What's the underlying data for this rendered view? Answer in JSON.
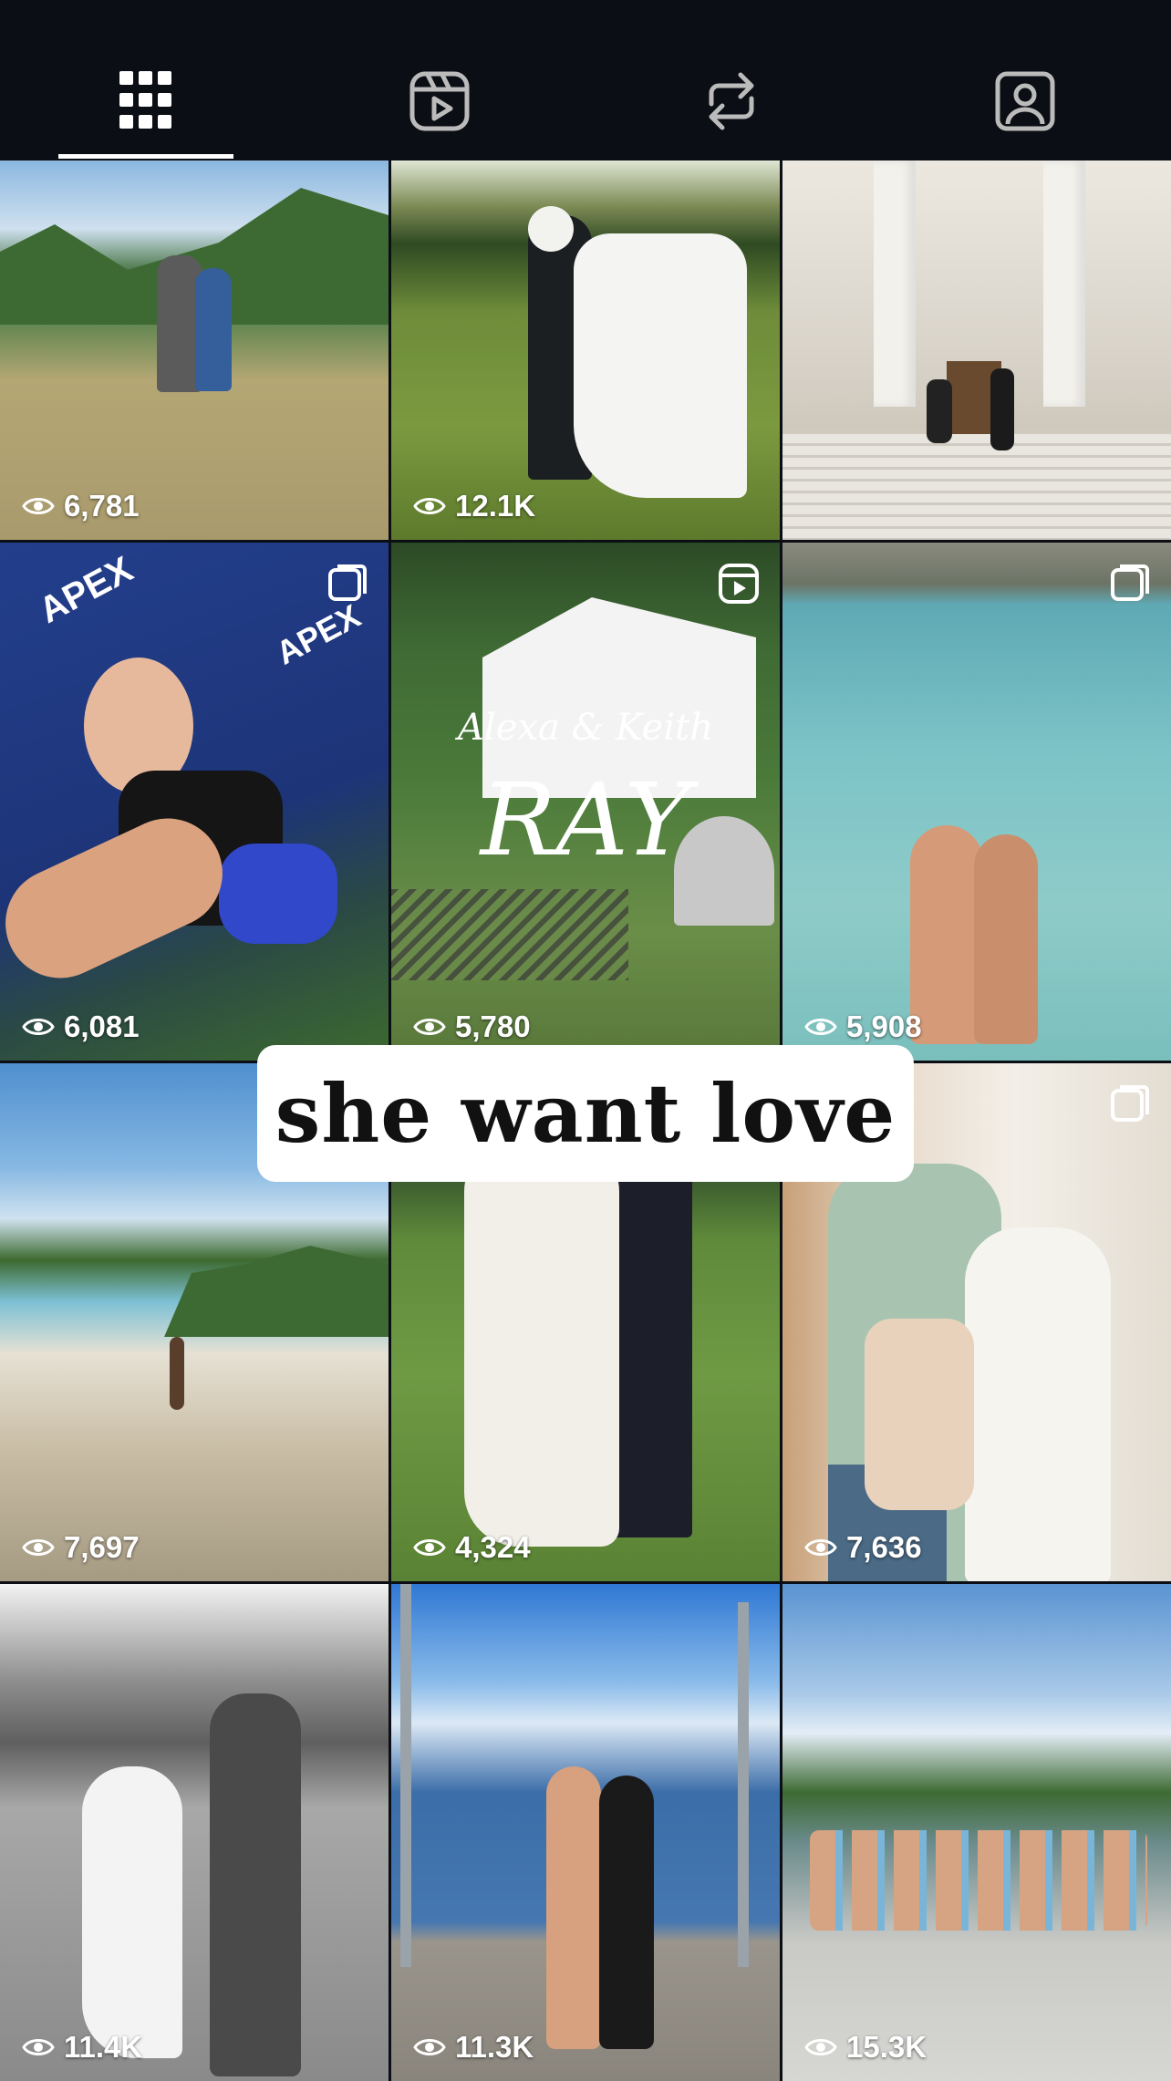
{
  "tabs": [
    {
      "name": "posts",
      "icon": "grid-icon",
      "selected": true
    },
    {
      "name": "reels",
      "icon": "reels-icon",
      "selected": false
    },
    {
      "name": "reposts",
      "icon": "repost-icon",
      "selected": false
    },
    {
      "name": "tagged",
      "icon": "tagged-person-icon",
      "selected": false
    }
  ],
  "posts": [
    {
      "views": "6,781",
      "badge": null
    },
    {
      "views": "12.1K",
      "badge": null
    },
    {
      "views": "",
      "badge": null
    },
    {
      "views": "6,081",
      "badge": "multi-photo-icon"
    },
    {
      "views": "5,780",
      "badge": "reel-icon"
    },
    {
      "views": "5,908",
      "badge": "multi-photo-icon"
    },
    {
      "views": "7,697",
      "badge": null
    },
    {
      "views": "4,324",
      "badge": null
    },
    {
      "views": "7,636",
      "badge": "multi-photo-icon"
    },
    {
      "views": "11.4K",
      "badge": null
    },
    {
      "views": "11.3K",
      "badge": null
    },
    {
      "views": "15.3K",
      "badge": null
    }
  ],
  "post_texts": {
    "wedding_names": "Alexa & Keith",
    "wedding_surname": "RAY",
    "apex": "APEX"
  },
  "overlay": {
    "text": "she want love"
  },
  "colors": {
    "background": "#0b0e14",
    "overlay_bg": "#ffffff",
    "overlay_text": "#111111"
  }
}
